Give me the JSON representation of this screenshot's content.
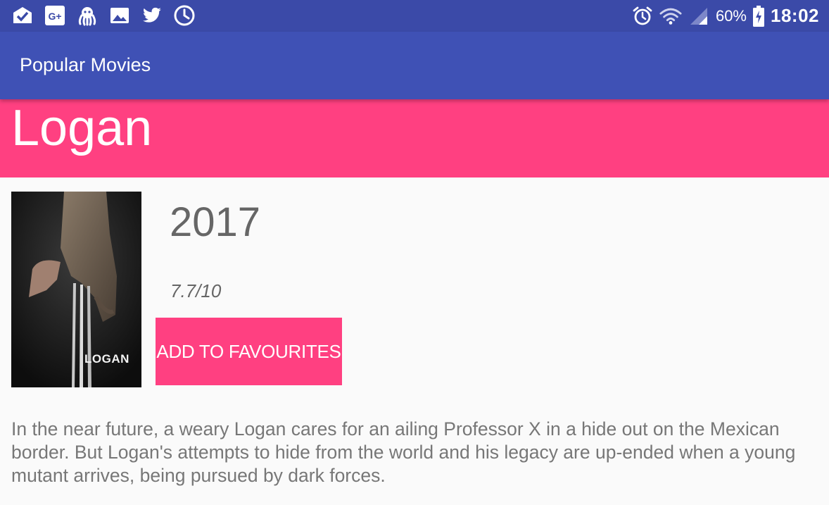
{
  "status_bar": {
    "left_icons": [
      "mail-check-icon",
      "google-plus-icon",
      "octopus-icon",
      "image-icon",
      "twitter-icon",
      "clock-icon"
    ],
    "right_icons": [
      "alarm-icon",
      "wifi-icon",
      "signal-icon",
      "battery-charging-icon"
    ],
    "battery": "60%",
    "time": "18:02"
  },
  "app_bar": {
    "title": "Popular Movies"
  },
  "movie": {
    "title": "Logan",
    "poster_caption": "LOGAN",
    "year": "2017",
    "rating": "7.7/10",
    "overview": "In the near future, a weary Logan cares for an ailing Professor X in a hide out on the Mexican border. But Logan's attempts to hide from the world and his legacy are up-ended when a young mutant arrives, being pursued by dark forces."
  },
  "actions": {
    "favourite_label": "ADD TO FAVOURITES"
  },
  "colors": {
    "status_bar": "#3b4aa8",
    "primary": "#3f51b5",
    "accent": "#ff4081",
    "background": "#fafafa",
    "text_secondary": "#666666"
  }
}
